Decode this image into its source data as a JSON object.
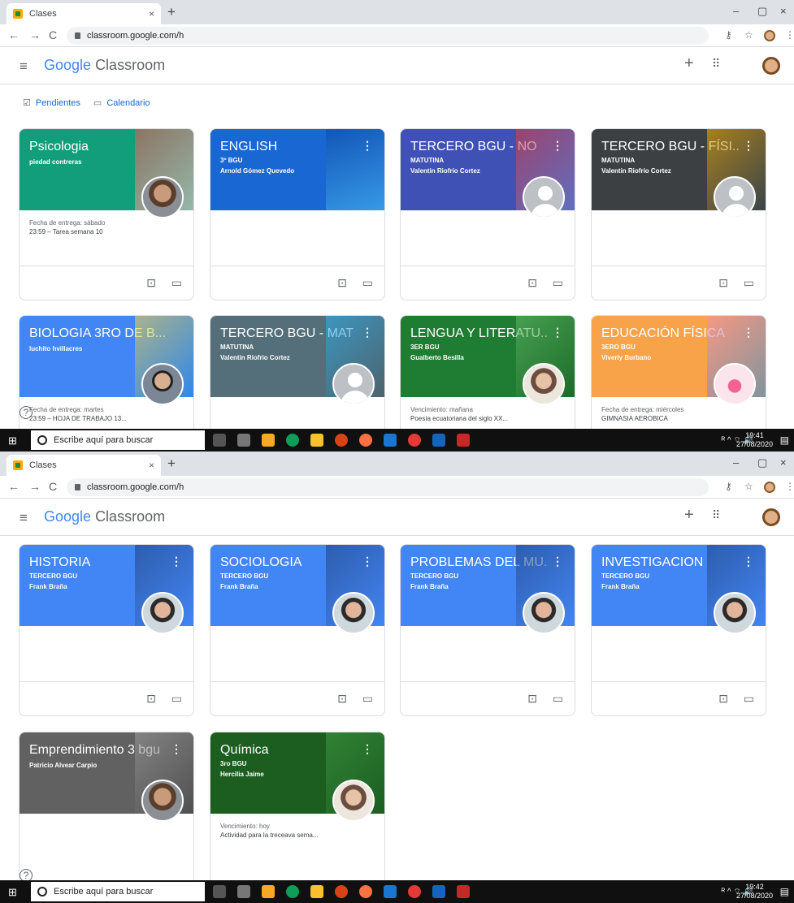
{
  "browser": {
    "tab_title": "Clases",
    "tab_close": "×",
    "new_tab": "+",
    "url": "classroom.google.com/h",
    "window_controls": [
      "–",
      "▢",
      "×"
    ]
  },
  "classroom_header": {
    "logo_google": "Google",
    "logo_classroom": "Classroom"
  },
  "subnav": {
    "pendientes": "Pendientes",
    "calendario": "Calendario"
  },
  "shot1_cards": [
    {
      "title": "Psicologia",
      "section": "",
      "teacher": "piedad contreras",
      "body1": "Fecha de entrega: sábado",
      "body2": "23:59 – Tarea semana 10"
    },
    {
      "title": "ENGLISH",
      "section": "3º BGU",
      "teacher": "Arnold Gómez Quevedo",
      "body1": "",
      "body2": ""
    },
    {
      "title": "TERCERO BGU - NO",
      "section": "MATUTINA",
      "teacher": "Valentin Riofrio Cortez",
      "body1": "",
      "body2": ""
    },
    {
      "title": "TERCERO BGU - FÍSI...",
      "section": "MATUTINA",
      "teacher": "Valentin Riofrio Cortez",
      "body1": "",
      "body2": ""
    },
    {
      "title": "BIOLOGIA 3RO DE B...",
      "section": "",
      "teacher": "luchito hvillacres",
      "body1": "Fecha de entrega: martes",
      "body2": "23:59 – HOJA DE TRABAJO 13..."
    },
    {
      "title": "TERCERO BGU - MAT",
      "section": "MATUTINA",
      "teacher": "Valentin Riofrio Cortez",
      "body1": "",
      "body2": ""
    },
    {
      "title": "LENGUA Y LITERATU...",
      "section": "3ER BGU",
      "teacher": "Gualberto Besilla",
      "body1": "Vencimiento: mañana",
      "body2": "Poesía ecuatoriana del siglo XX..."
    },
    {
      "title": "EDUCACIÓN FÍSICA",
      "section": "3ERO BGU",
      "teacher": "Viverly Burbano",
      "body1": "Fecha de entrega: miércoles",
      "body2": "GIMNASIA AEROBICA"
    }
  ],
  "shot2_cards": [
    {
      "title": "HISTORIA",
      "section": "TERCERO BGU",
      "teacher": "Frank Braña",
      "body1": "",
      "body2": ""
    },
    {
      "title": "SOCIOLOGIA",
      "section": "TERCERO BGU",
      "teacher": "Frank Braña",
      "body1": "",
      "body2": ""
    },
    {
      "title": "PROBLEMAS DEL MU...",
      "section": "TERCERO BGU",
      "teacher": "Frank Braña",
      "body1": "",
      "body2": ""
    },
    {
      "title": "INVESTIGACION",
      "section": "TERCERO BGU",
      "teacher": "Frank Braña",
      "body1": "",
      "body2": ""
    },
    {
      "title": "Emprendimiento 3 bgu",
      "section": "",
      "teacher": "Patricio Alvear Carpio",
      "body1": "",
      "body2": ""
    },
    {
      "title": "Química",
      "section": "3ro BGU",
      "teacher": "Hercilia Jaime",
      "body1": "Vencimiento: hoy",
      "body2": "Actividad para la treceava sema..."
    }
  ],
  "taskbar": {
    "search_placeholder": "Escribe aquí para buscar",
    "time1": "19:41",
    "time2": "19:42",
    "date": "27/08/2020"
  },
  "colors": {
    "accent": "#1967d2",
    "teal": "#129e7a",
    "orange": "#f8a34a"
  }
}
